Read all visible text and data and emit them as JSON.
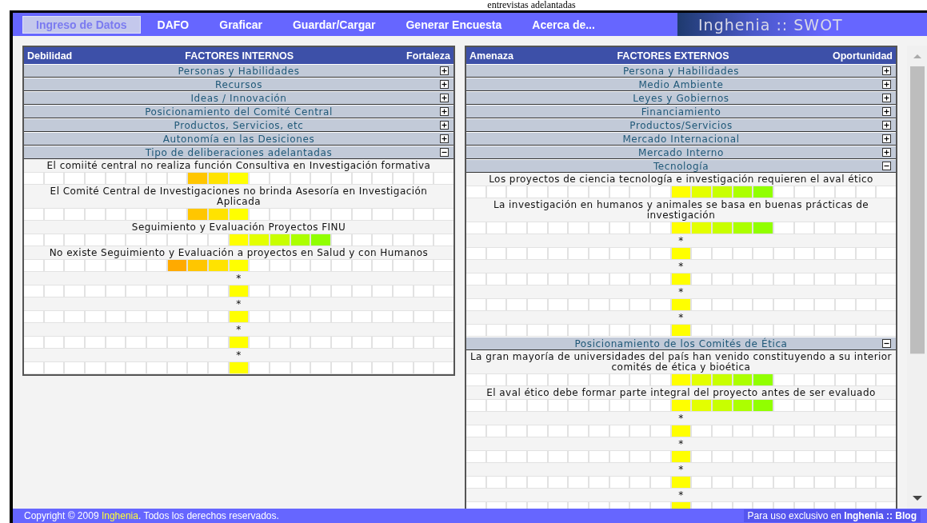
{
  "page_title": "entrevistas adelantadas",
  "nav": [
    {
      "label": "Ingreso de Datos",
      "selected": true
    },
    {
      "label": "DAFO",
      "selected": false
    },
    {
      "label": "Graficar",
      "selected": false
    },
    {
      "label": "Guardar/Cargar",
      "selected": false
    },
    {
      "label": "Generar Encuesta",
      "selected": false
    },
    {
      "label": "Acerca de...",
      "selected": false
    }
  ],
  "logo": "Inghenia :: SWOT",
  "panels": [
    {
      "left_label": "Debilidad",
      "title": "FACTORES INTERNOS",
      "right_label": "Fortaleza",
      "categories": [
        {
          "label": "Personas y Habilidades",
          "expanded": false
        },
        {
          "label": "Recursos",
          "expanded": false
        },
        {
          "label": "Ideas / Innovación",
          "expanded": false
        },
        {
          "label": "Posicionamiento del Comité Central",
          "expanded": false
        },
        {
          "label": "Productos, Servicios, etc",
          "expanded": false
        },
        {
          "label": "Autonomía en las Desiciones",
          "expanded": false
        },
        {
          "label": "Tipo de deliberaciones adelantadas",
          "expanded": true,
          "items": [
            {
              "text": "El comiité central no realiza  función Consultiva en Investigación formativa",
              "cells": [
                false,
                false,
                false,
                false,
                false,
                false,
                false,
                false,
                true,
                true,
                true,
                false,
                false,
                false,
                false,
                false,
                false,
                false,
                false,
                false,
                false
              ]
            },
            {
              "text": "El Comité Central de Investigaciones no brinda Asesoría en Investigación Aplicada",
              "cells": [
                false,
                false,
                false,
                false,
                false,
                false,
                false,
                false,
                true,
                true,
                true,
                false,
                false,
                false,
                false,
                false,
                false,
                false,
                false,
                false,
                false
              ]
            },
            {
              "text": "Seguimiento y Evaluación Proyectos FINU",
              "cells": [
                false,
                false,
                false,
                false,
                false,
                false,
                false,
                false,
                false,
                false,
                true,
                true,
                true,
                true,
                true,
                false,
                false,
                false,
                false,
                false,
                false
              ]
            },
            {
              "text": "No existe Seguimiento y Evaluación a proyectos en Salud y con Humanos",
              "cells": [
                false,
                false,
                false,
                false,
                false,
                false,
                false,
                true,
                true,
                true,
                true,
                false,
                false,
                false,
                false,
                false,
                false,
                false,
                false,
                false,
                false
              ]
            },
            {
              "text": "*",
              "cells": [
                false,
                false,
                false,
                false,
                false,
                false,
                false,
                false,
                false,
                false,
                true,
                false,
                false,
                false,
                false,
                false,
                false,
                false,
                false,
                false,
                false
              ]
            },
            {
              "text": "*",
              "cells": [
                false,
                false,
                false,
                false,
                false,
                false,
                false,
                false,
                false,
                false,
                true,
                false,
                false,
                false,
                false,
                false,
                false,
                false,
                false,
                false,
                false
              ]
            },
            {
              "text": "*",
              "cells": [
                false,
                false,
                false,
                false,
                false,
                false,
                false,
                false,
                false,
                false,
                true,
                false,
                false,
                false,
                false,
                false,
                false,
                false,
                false,
                false,
                false
              ]
            },
            {
              "text": "*",
              "cells": [
                false,
                false,
                false,
                false,
                false,
                false,
                false,
                false,
                false,
                false,
                true,
                false,
                false,
                false,
                false,
                false,
                false,
                false,
                false,
                false,
                false
              ]
            }
          ]
        }
      ]
    },
    {
      "left_label": "Amenaza",
      "title": "FACTORES EXTERNOS",
      "right_label": "Oportunidad",
      "categories": [
        {
          "label": "Persona y Habilidades",
          "expanded": false
        },
        {
          "label": "Medio Ambiente",
          "expanded": false
        },
        {
          "label": "Leyes y Gobiernos",
          "expanded": false
        },
        {
          "label": "Financiamiento",
          "expanded": false
        },
        {
          "label": "Productos/Servicios",
          "expanded": false
        },
        {
          "label": "Mercado Internacional",
          "expanded": false
        },
        {
          "label": "Mercado Interno",
          "expanded": false
        },
        {
          "label": "Tecnología",
          "expanded": true,
          "items": [
            {
              "text": "Los proyectos de ciencia tecnología e investigación requieren el aval ético",
              "cells": [
                false,
                false,
                false,
                false,
                false,
                false,
                false,
                false,
                false,
                false,
                true,
                true,
                true,
                true,
                true,
                false,
                false,
                false,
                false,
                false,
                false
              ]
            },
            {
              "text": "La investigación en humanos y animales se basa en buenas prácticas de investigación",
              "cells": [
                false,
                false,
                false,
                false,
                false,
                false,
                false,
                false,
                false,
                false,
                true,
                true,
                true,
                true,
                true,
                false,
                false,
                false,
                false,
                false,
                false
              ]
            },
            {
              "text": "*",
              "cells": [
                false,
                false,
                false,
                false,
                false,
                false,
                false,
                false,
                false,
                false,
                true,
                false,
                false,
                false,
                false,
                false,
                false,
                false,
                false,
                false,
                false
              ]
            },
            {
              "text": "*",
              "cells": [
                false,
                false,
                false,
                false,
                false,
                false,
                false,
                false,
                false,
                false,
                true,
                false,
                false,
                false,
                false,
                false,
                false,
                false,
                false,
                false,
                false
              ]
            },
            {
              "text": "*",
              "cells": [
                false,
                false,
                false,
                false,
                false,
                false,
                false,
                false,
                false,
                false,
                true,
                false,
                false,
                false,
                false,
                false,
                false,
                false,
                false,
                false,
                false
              ]
            },
            {
              "text": "*",
              "cells": [
                false,
                false,
                false,
                false,
                false,
                false,
                false,
                false,
                false,
                false,
                true,
                false,
                false,
                false,
                false,
                false,
                false,
                false,
                false,
                false,
                false
              ]
            }
          ]
        },
        {
          "label": "Posicionamiento de los Comités de Ética",
          "expanded": true,
          "items": [
            {
              "text": "La gran mayoría de universidades del país han venido constituyendo a su interior comités de ética y bioética",
              "cells": [
                false,
                false,
                false,
                false,
                false,
                false,
                false,
                false,
                false,
                false,
                true,
                true,
                true,
                true,
                true,
                false,
                false,
                false,
                false,
                false,
                false
              ]
            },
            {
              "text": "El aval ético debe formar parte integral del proyecto antes de ser evaluado",
              "cells": [
                false,
                false,
                false,
                false,
                false,
                false,
                false,
                false,
                false,
                false,
                true,
                true,
                true,
                true,
                true,
                false,
                false,
                false,
                false,
                false,
                false
              ]
            },
            {
              "text": "*",
              "cells": [
                false,
                false,
                false,
                false,
                false,
                false,
                false,
                false,
                false,
                false,
                true,
                false,
                false,
                false,
                false,
                false,
                false,
                false,
                false,
                false,
                false
              ]
            },
            {
              "text": "*",
              "cells": [
                false,
                false,
                false,
                false,
                false,
                false,
                false,
                false,
                false,
                false,
                true,
                false,
                false,
                false,
                false,
                false,
                false,
                false,
                false,
                false,
                false
              ]
            },
            {
              "text": "*",
              "cells": [
                false,
                false,
                false,
                false,
                false,
                false,
                false,
                false,
                false,
                false,
                true,
                false,
                false,
                false,
                false,
                false,
                false,
                false,
                false,
                false,
                false
              ]
            },
            {
              "text": "*",
              "cells": [
                false,
                false,
                false,
                false,
                false,
                false,
                false,
                false,
                false,
                false,
                true,
                false,
                false,
                false,
                false,
                false,
                false,
                false,
                false,
                false,
                false
              ]
            }
          ]
        }
      ]
    }
  ],
  "footer": {
    "copyright": "Copyright © 2009 **Inghenia**. Todos los derechos reservados.",
    "notice": "Para uso exclusivo en **Inghenia :: Blog**"
  }
}
